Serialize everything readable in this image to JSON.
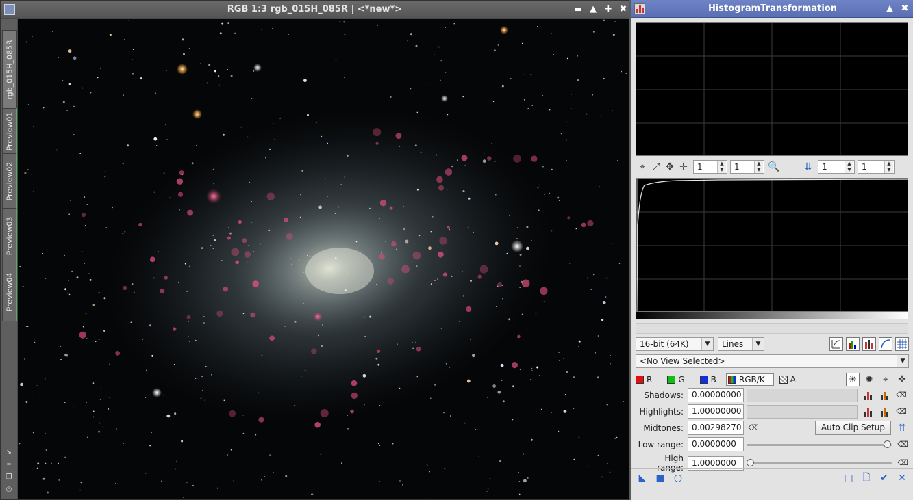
{
  "image_window": {
    "title": "RGB 1:3 rgb_015H_085R | <*new*>",
    "main_tab": "rgb_015H_085R",
    "preview_tabs": [
      "Preview01",
      "Preview02",
      "Preview03",
      "Preview04"
    ]
  },
  "panel": {
    "title": "HistogramTransformation",
    "zoom": {
      "h1": "1",
      "v1": "1",
      "h2": "1",
      "v2": "1"
    },
    "resolution": "16-bit (64K)",
    "graph_style": "Lines",
    "view_select": "<No View Selected>",
    "channels": [
      {
        "label": "R",
        "color": "#e01010"
      },
      {
        "label": "G",
        "color": "#10c010"
      },
      {
        "label": "B",
        "color": "#1030e0"
      },
      {
        "label": "RGB/K",
        "color": "#888888"
      },
      {
        "label": "A",
        "color": "#cccccc"
      }
    ],
    "params": {
      "shadows_label": "Shadows:",
      "shadows": "0.00000000",
      "highlights_label": "Highlights:",
      "highlights": "1.00000000",
      "midtones_label": "Midtones:",
      "midtones": "0.00298270",
      "low_range_label": "Low range:",
      "low_range": "0.0000000",
      "high_range_label": "High range:",
      "high_range": "1.0000000"
    },
    "auto_clip_label": "Auto Clip Setup"
  }
}
